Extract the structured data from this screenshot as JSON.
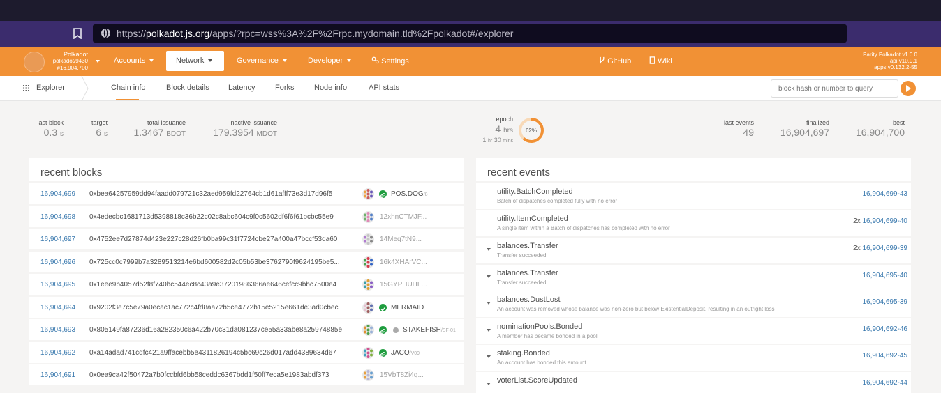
{
  "browser": {
    "url_prefix": "https://",
    "url_domain": "polkadot.js.org",
    "url_rest": "/apps/?rpc=wss%3A%2F%2Frpc.mydomain.tld%2Fpolkadot#/explorer"
  },
  "chain": {
    "name": "Polkadot",
    "spec": "polkadot/9430",
    "block": "#16,904,700"
  },
  "nav": {
    "items": [
      "Accounts",
      "Network",
      "Governance",
      "Developer",
      "Settings"
    ],
    "github": "GitHub",
    "wiki": "Wiki",
    "version": [
      "Parity Polkadot v1.0.0",
      "api v10.9.1",
      "apps v0.132.2-55"
    ]
  },
  "subnav": {
    "section": "Explorer",
    "tabs": [
      "Chain info",
      "Block details",
      "Latency",
      "Forks",
      "Node info",
      "API stats"
    ],
    "active_tab": "Chain info",
    "search_placeholder": "block hash or number to query"
  },
  "stats": {
    "last_block": {
      "label": "last block",
      "value": "0.3",
      "unit": "s"
    },
    "target": {
      "label": "target",
      "value": "6",
      "unit": "s"
    },
    "total_issuance": {
      "label": "total issuance",
      "value": "1.3467",
      "unit": "BDOT"
    },
    "inactive_issuance": {
      "label": "inactive issuance",
      "value": "179.3954",
      "unit": "MDOT"
    },
    "epoch": {
      "label": "epoch",
      "value": "4",
      "unit": "hrs",
      "sub_h": "1",
      "sub_h_unit": "hr",
      "sub_m": "30",
      "sub_m_unit": "mins",
      "percent_text": "62%",
      "fraction": 0.62
    },
    "last_events": {
      "label": "last events",
      "value": "49"
    },
    "finalized": {
      "label": "finalized",
      "value": "16,904,697"
    },
    "best": {
      "label": "best",
      "value": "16,904,700"
    }
  },
  "colors": {
    "accent": "#f19135",
    "link": "#3a79ae",
    "verified": "#1f9d3f"
  },
  "recent_blocks": {
    "title": "recent blocks",
    "rows": [
      {
        "number": "16,904,699",
        "hash": "0xbea64257959dd94faadd079721c32aed959fd22764cb1d61afff73e3d17d96f5",
        "author": "POS.DOG",
        "suffix": "/8",
        "badge": "link",
        "dim": false
      },
      {
        "number": "16,904,698",
        "hash": "0x4edecbc1681713d5398818c36b22c02c8abc604c9f0c5602df6f6f61bcbc55e9",
        "author": "12xhnCTMJF...",
        "suffix": "",
        "badge": "",
        "dim": true
      },
      {
        "number": "16,904,697",
        "hash": "0x4752ee7d27874d423e227c28d26fb0ba99c31f7724cbe27a400a47bccf53da60",
        "author": "14Meq7tN9...",
        "suffix": "",
        "badge": "",
        "dim": true
      },
      {
        "number": "16,904,696",
        "hash": "0x725cc0c7999b7a3289513214e6bd600582d2c05b53be3762790f9624195be5...",
        "author": "16k4XHArVC...",
        "suffix": "",
        "badge": "",
        "dim": true
      },
      {
        "number": "16,904,695",
        "hash": "0x1eee9b4057d52f8f740bc544ec8c43a9e37201986366ae646cefcc9bbc7500e4",
        "author": "15GYPHUHL...",
        "suffix": "",
        "badge": "",
        "dim": true
      },
      {
        "number": "16,904,694",
        "hash": "0x9202f3e7c5e79a0ecac1ac772c4fd8aa72b5ce4772b15e5215e661de3ad0cbec",
        "author": "MERMAID",
        "suffix": "",
        "badge": "check",
        "dim": false
      },
      {
        "number": "16,904,693",
        "hash": "0x805149fa87236d16a282350c6a422b70c31da081237ce55a33abe8a25974885e",
        "author": "STAKEFISH",
        "suffix": "/SF-01",
        "badge": "link",
        "dim": false
      },
      {
        "number": "16,904,692",
        "hash": "0xa14adad741cdfc421a9ffacebb5e4311826194c5bc69c26d017add4389634d67",
        "author": "JACO",
        "suffix": "/V09",
        "badge": "link",
        "dim": false
      },
      {
        "number": "16,904,691",
        "hash": "0x0ea9ca42f50472a7b0fccbfd6bb58ceddc6367bdd1f50ff7eca5e1983abdf373",
        "author": "15VbT8Zi4q...",
        "suffix": "",
        "badge": "",
        "dim": true
      }
    ]
  },
  "recent_events": {
    "title": "recent events",
    "rows": [
      {
        "name": "utility.BatchCompleted",
        "desc": "Batch of dispatches completed fully with no error",
        "count": "",
        "ref": "16,904,699-43",
        "expand": false
      },
      {
        "name": "utility.ItemCompleted",
        "desc": "A single item within a Batch of dispatches has completed with no error",
        "count": "2x",
        "ref": "16,904,699-40",
        "expand": false
      },
      {
        "name": "balances.Transfer",
        "desc": "Transfer succeeded",
        "count": "2x",
        "ref": "16,904,699-39",
        "expand": true
      },
      {
        "name": "balances.Transfer",
        "desc": "Transfer succeeded",
        "count": "",
        "ref": "16,904,695-40",
        "expand": true
      },
      {
        "name": "balances.DustLost",
        "desc": "An account was removed whose balance was non-zero but below ExistentialDeposit, resulting in an outright loss",
        "count": "",
        "ref": "16,904,695-39",
        "expand": true
      },
      {
        "name": "nominationPools.Bonded",
        "desc": "A member has became bonded in a pool",
        "count": "",
        "ref": "16,904,692-46",
        "expand": true
      },
      {
        "name": "staking.Bonded",
        "desc": "An account has bonded this amount",
        "count": "",
        "ref": "16,904,692-45",
        "expand": true
      },
      {
        "name": "voterList.ScoreUpdated",
        "desc": "",
        "count": "",
        "ref": "16,904,692-44",
        "expand": true
      }
    ]
  }
}
